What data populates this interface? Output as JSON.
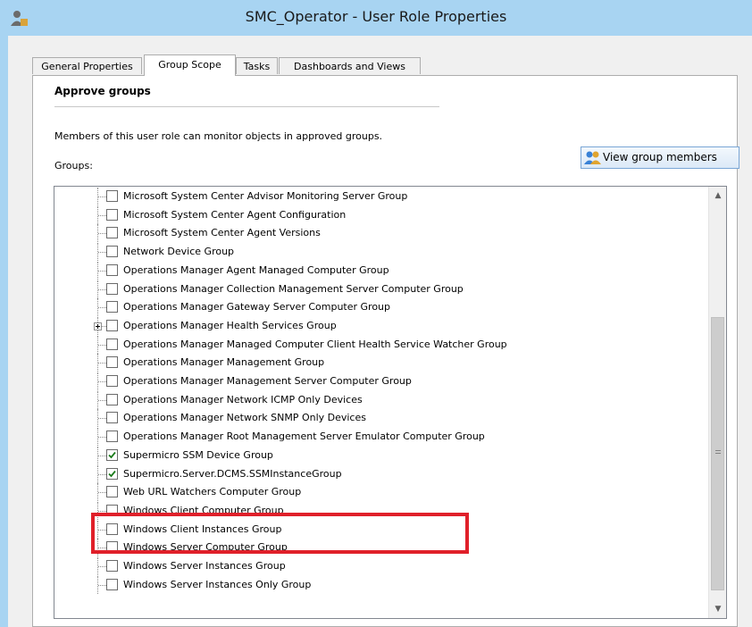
{
  "window": {
    "title": "SMC_Operator - User Role Properties",
    "icon": "user-role-icon"
  },
  "tabs": [
    {
      "label": "General Properties",
      "active": false
    },
    {
      "label": "Group Scope",
      "active": true
    },
    {
      "label": "Tasks",
      "active": false
    },
    {
      "label": "Dashboards and Views",
      "active": false
    }
  ],
  "panel": {
    "section_title": "Approve groups",
    "description": "Members of this user role can monitor objects in approved groups.",
    "groups_label": "Groups:",
    "view_button": {
      "label": "View group members",
      "icon": "group-members-icon"
    }
  },
  "groups": [
    {
      "label": "Microsoft System Center Advisor Monitoring Server Group",
      "checked": false
    },
    {
      "label": "Microsoft System Center Agent Configuration",
      "checked": false
    },
    {
      "label": "Microsoft System Center Agent Versions",
      "checked": false
    },
    {
      "label": "Network Device Group",
      "checked": false
    },
    {
      "label": "Operations Manager Agent Managed Computer Group",
      "checked": false
    },
    {
      "label": "Operations Manager Collection Management Server Computer Group",
      "checked": false
    },
    {
      "label": "Operations Manager Gateway Server Computer Group",
      "checked": false
    },
    {
      "label": "Operations Manager Health Services Group",
      "checked": false,
      "expandable": true
    },
    {
      "label": "Operations Manager Managed Computer Client Health Service Watcher Group",
      "checked": false
    },
    {
      "label": "Operations Manager Management Group",
      "checked": false
    },
    {
      "label": "Operations Manager Management Server Computer Group",
      "checked": false
    },
    {
      "label": "Operations Manager Network ICMP Only Devices",
      "checked": false
    },
    {
      "label": "Operations Manager Network SNMP Only Devices",
      "checked": false
    },
    {
      "label": "Operations Manager Root Management Server Emulator Computer Group",
      "checked": false
    },
    {
      "label": "Supermicro SSM Device Group",
      "checked": true
    },
    {
      "label": "Supermicro.Server.DCMS.SSMInstanceGroup",
      "checked": true
    },
    {
      "label": "Web URL Watchers Computer Group",
      "checked": false
    },
    {
      "label": "Windows Client Computer Group",
      "checked": false
    },
    {
      "label": "Windows Client Instances Group",
      "checked": false
    },
    {
      "label": "Windows Server Computer Group",
      "checked": false
    },
    {
      "label": "Windows Server Instances Group",
      "checked": false
    },
    {
      "label": "Windows Server Instances Only Group",
      "checked": false
    }
  ],
  "colors": {
    "title_bar": "#a8d4f2",
    "highlight": "#e0202a",
    "check": "#1a7a1a"
  }
}
